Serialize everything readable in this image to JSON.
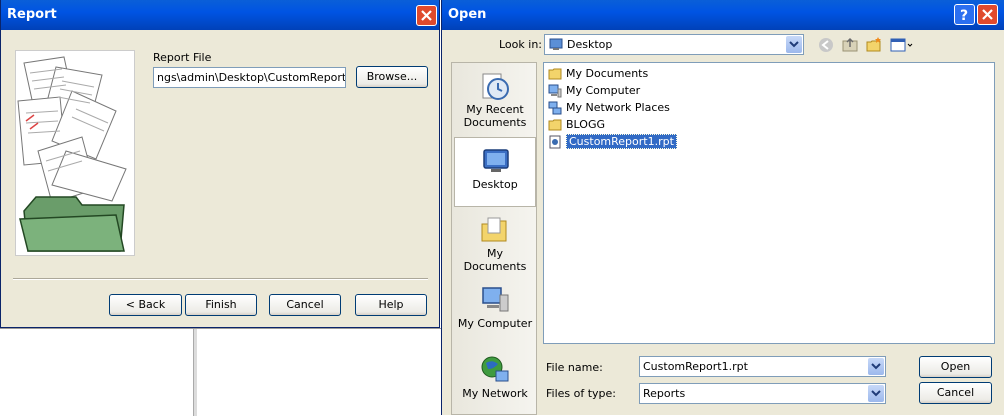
{
  "report": {
    "title": "Report",
    "report_file_label": "Report File",
    "report_file_value": "ngs\\admin\\Desktop\\CustomReport1.rpt",
    "browse_label": "Browse...",
    "back_label": "< Back",
    "finish_label": "Finish",
    "cancel_label": "Cancel",
    "help_label": "Help"
  },
  "open": {
    "title": "Open",
    "look_in_label": "Look in:",
    "look_in_value": "Desktop",
    "places": [
      "My Recent Documents",
      "Desktop",
      "My Documents",
      "My Computer",
      "My Network"
    ],
    "items": [
      {
        "label": "My Documents",
        "icon": "folder-icon"
      },
      {
        "label": "My Computer",
        "icon": "computer-icon"
      },
      {
        "label": "My Network Places",
        "icon": "network-icon"
      },
      {
        "label": "BLOGG",
        "icon": "folder-icon"
      },
      {
        "label": "CustomReport1.rpt",
        "icon": "report-file-icon",
        "selected": true
      }
    ],
    "file_name_label": "File name:",
    "file_name_value": "CustomReport1.rpt",
    "files_of_type_label": "Files of type:",
    "files_of_type_value": "Reports",
    "open_label": "Open",
    "cancel_label": "Cancel"
  },
  "colors": {
    "titlebar": "#0054e3",
    "dialog_bg": "#ece9d8",
    "selection": "#316ac5",
    "close_button": "#e04a2d"
  }
}
